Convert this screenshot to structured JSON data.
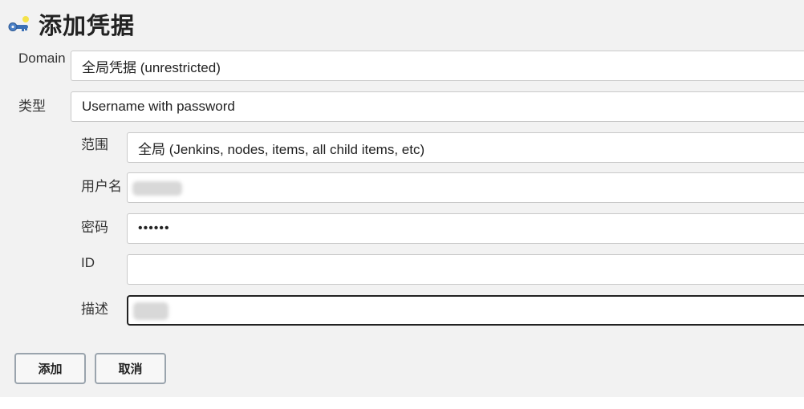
{
  "page": {
    "title": "添加凭据"
  },
  "domain": {
    "label": "Domain",
    "value": "全局凭据 (unrestricted)"
  },
  "kind": {
    "label": "类型",
    "value": "Username with password"
  },
  "scope": {
    "label": "范围",
    "value": "全局 (Jenkins, nodes, items, all child items, etc)"
  },
  "username": {
    "label": "用户名",
    "value": ""
  },
  "password": {
    "label": "密码",
    "value": "••••••"
  },
  "id": {
    "label": "ID",
    "value": ""
  },
  "description": {
    "label": "描述",
    "value": ""
  },
  "buttons": {
    "add": "添加",
    "cancel": "取消"
  }
}
